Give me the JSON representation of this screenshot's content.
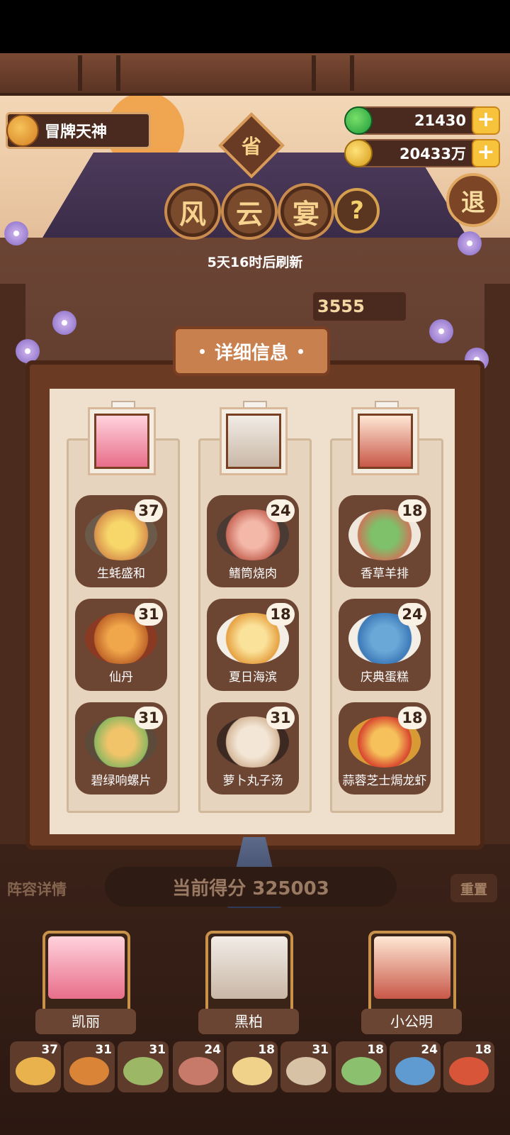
{
  "player": {
    "title": "冒牌天神"
  },
  "currency": {
    "jade": "21430",
    "coins": "20433万"
  },
  "province_badge": "省",
  "title": [
    "风",
    "云",
    "宴"
  ],
  "help_icon": "?",
  "exit_label": "退",
  "refresh_text": "5天16时后刷新",
  "score_tag": "3555",
  "panel": {
    "title": "详细信息",
    "columns": [
      {
        "dishes": [
          {
            "name": "生蚝盛和",
            "count": "37"
          },
          {
            "name": "仙丹",
            "count": "31"
          },
          {
            "name": "碧绿响螺片",
            "count": "31"
          }
        ]
      },
      {
        "dishes": [
          {
            "name": "鳍筒烧肉",
            "count": "24"
          },
          {
            "name": "夏日海滨",
            "count": "18"
          },
          {
            "name": "萝卜丸子汤",
            "count": "31"
          }
        ]
      },
      {
        "dishes": [
          {
            "name": "香草羊排",
            "count": "18"
          },
          {
            "name": "庆典蛋糕",
            "count": "24"
          },
          {
            "name": "蒜蓉芝士焗龙虾",
            "count": "18"
          }
        ]
      }
    ]
  },
  "lower": {
    "lineup_label": "阵容详情",
    "current_score": "当前得分 325003",
    "reset_label": "重置",
    "heroes": [
      "凯丽",
      "黑柏",
      "小公明"
    ],
    "slots": [
      "37",
      "31",
      "31",
      "24",
      "18",
      "31",
      "18",
      "24",
      "18"
    ]
  },
  "colors": {
    "accent": "#c8804f",
    "panel_bg": "#efe0cd",
    "gold": "#f7c23c"
  }
}
